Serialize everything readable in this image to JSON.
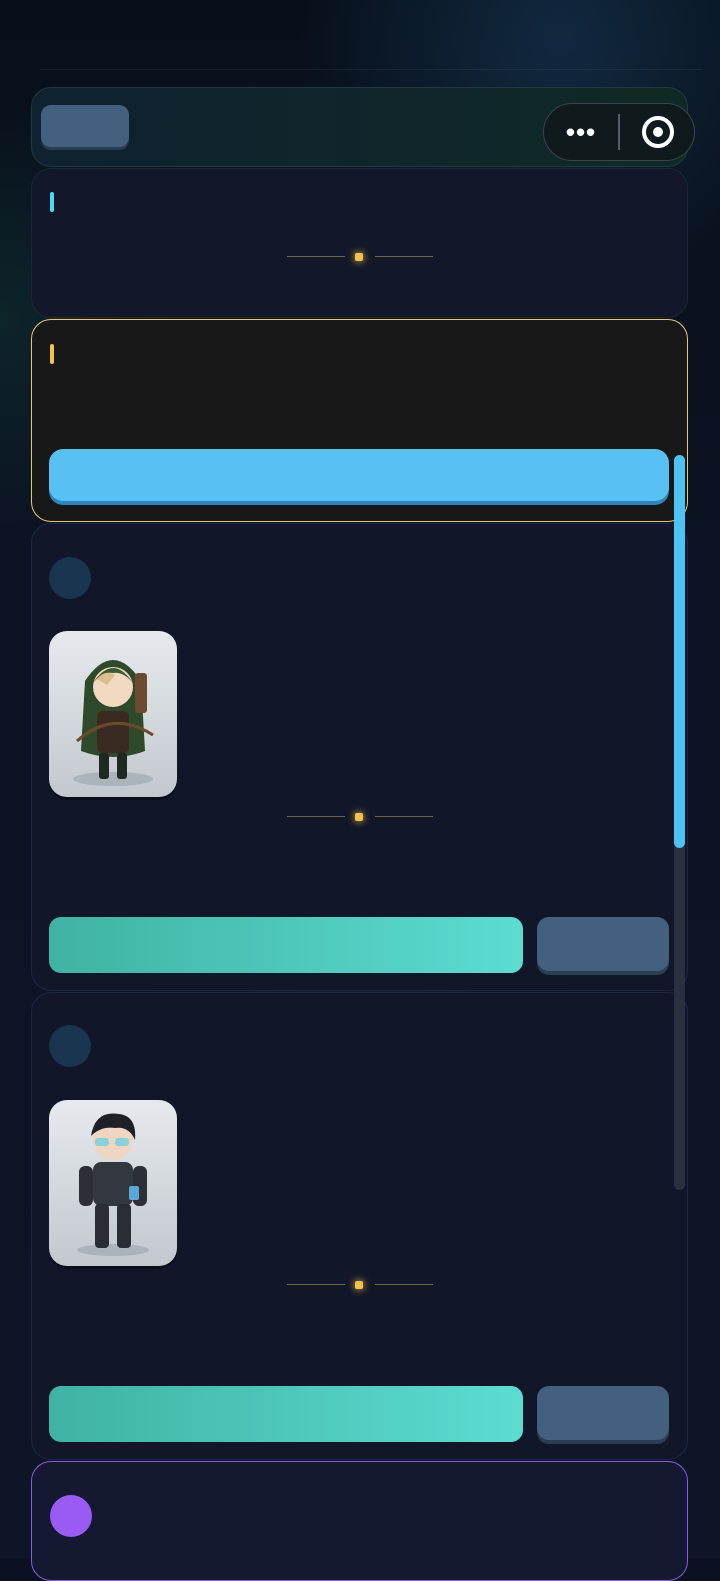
{
  "header": {
    "menu_glyph": "•••",
    "menu_icon": "more-dots-icon",
    "close_icon": "target-circle-icon"
  },
  "colors": {
    "cyan_accent": "#4fd8f0",
    "gold_accent": "#f2c14e",
    "blue_button": "#56c1f2",
    "teal_button": "#4fc9bb",
    "slate_button": "#44607f",
    "purple_accent": "#9a5bf4",
    "card_bg": "#121629"
  },
  "characters": [
    {
      "avatar_icon": "archer-portrait-icon"
    },
    {
      "avatar_icon": "tactical-glasses-portrait-icon"
    }
  ],
  "scroll": {
    "visible_fraction": 0.53
  }
}
